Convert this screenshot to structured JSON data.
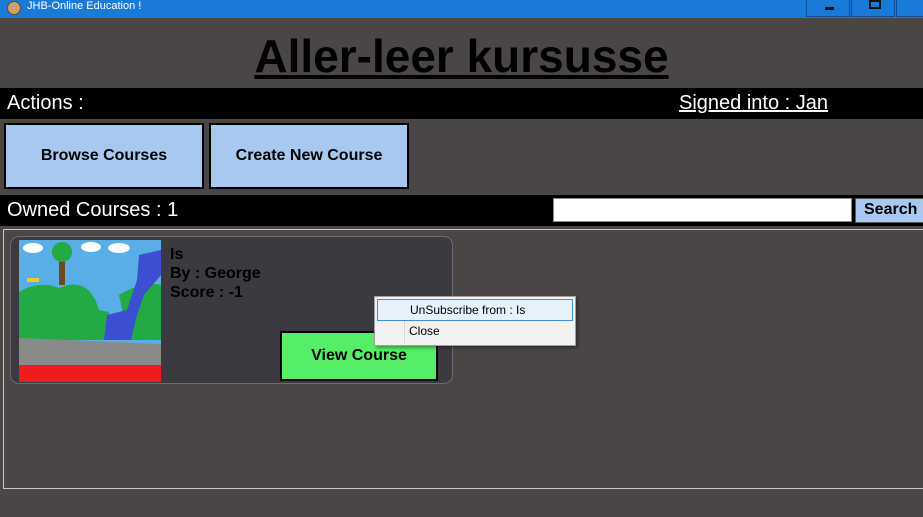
{
  "window": {
    "title": "JHB-Online Education !",
    "controls": {
      "minimize": "▁",
      "maximize": "▭",
      "close": "✕"
    }
  },
  "page_title": "Aller-leer kursusse",
  "actions_bar": {
    "label": "Actions :",
    "signed_in": "Signed into : Jan"
  },
  "buttons": {
    "browse": "Browse Courses",
    "create": "Create New Course"
  },
  "owned_bar": {
    "label": "Owned Courses : 1",
    "search_value": "",
    "search_button": "Search"
  },
  "courses": [
    {
      "name": "Is",
      "author": "By : George",
      "score": "Score : -1",
      "view_button": "View Course"
    }
  ],
  "context_menu": {
    "items": [
      "UnSubscribe from : Is",
      "Close"
    ],
    "highlighted": "UnSubscribe from : Is"
  },
  "colors": {
    "background": "#4a4646",
    "action_button": "#a9c8ef",
    "view_button": "#55ee66",
    "titlebar": "#1a7ad8"
  }
}
